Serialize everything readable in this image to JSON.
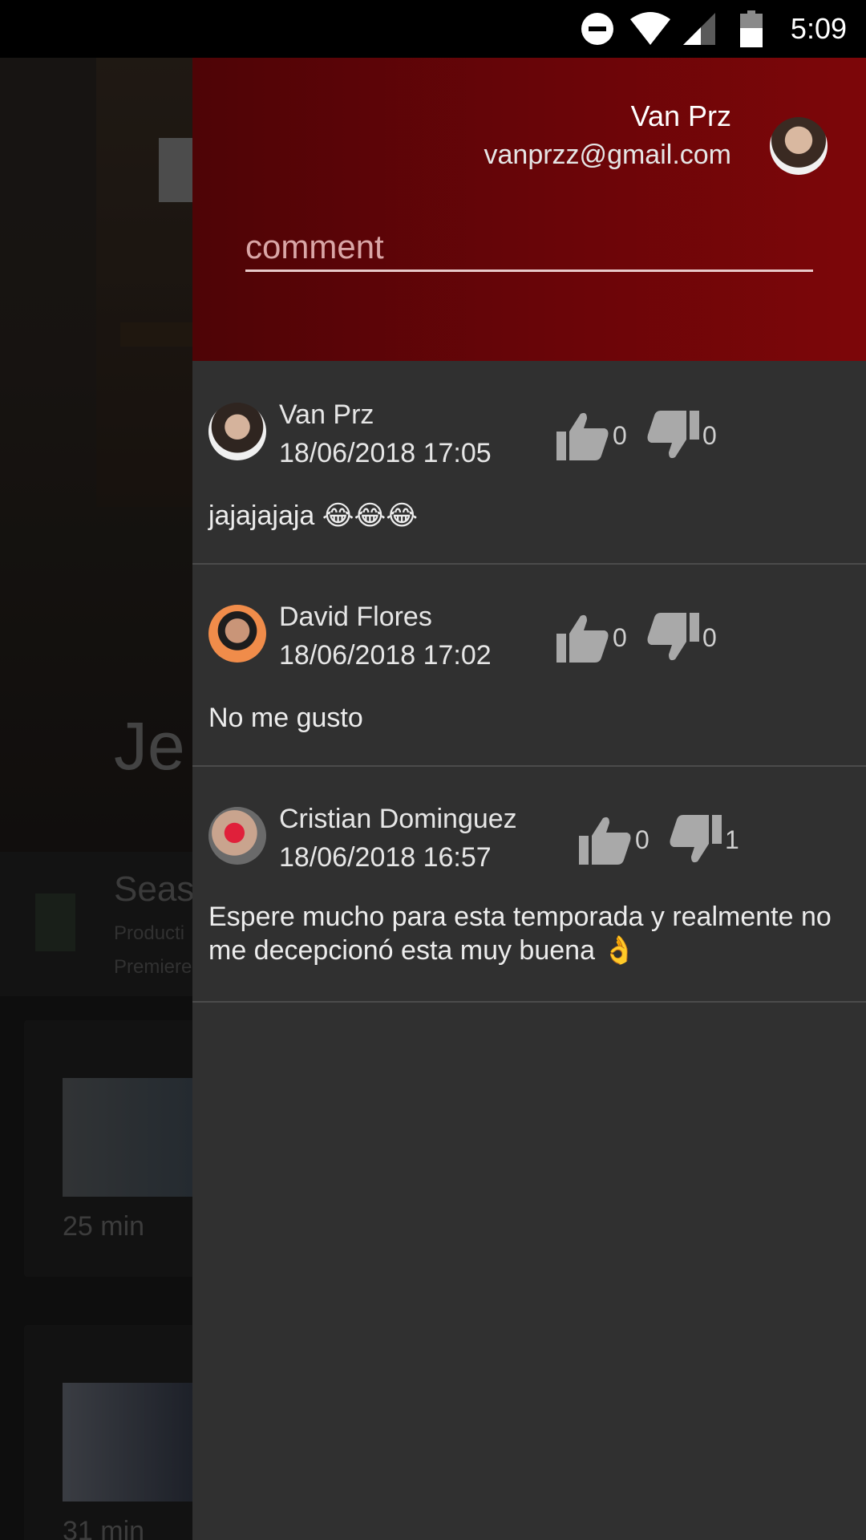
{
  "status_bar": {
    "time": "5:09",
    "icons": [
      "do-not-disturb-icon",
      "wifi-icon",
      "cellular-signal-icon",
      "battery-icon"
    ]
  },
  "background": {
    "show_title_partial": "Je",
    "season_title_partial": "Seas",
    "season_line1_partial": "Producti",
    "season_line2_partial": "Premiere",
    "episodes": [
      {
        "duration": "25 min"
      },
      {
        "duration": "31 min"
      }
    ]
  },
  "drawer": {
    "user": {
      "name": "Van Prz",
      "email": "vanprzz@gmail.com"
    },
    "comment_input": {
      "placeholder": "comment",
      "value": ""
    },
    "comments": [
      {
        "author": "Van Prz",
        "date": "18/06/2018 17:05",
        "likes": "0",
        "dislikes": "0",
        "text": "jajajajaja 😂😂😂"
      },
      {
        "author": "David Flores",
        "date": "18/06/2018 17:02",
        "likes": "0",
        "dislikes": "0",
        "text": "No me gusto"
      },
      {
        "author": "Cristian Dominguez",
        "date": "18/06/2018 16:57",
        "likes": "0",
        "dislikes": "1",
        "text": "Espere mucho para esta temporada y realmente no me decepcionó esta muy buena 👌"
      }
    ]
  },
  "colors": {
    "header_red": "#6a0508",
    "drawer_bg": "#303030",
    "divider": "#4b4b4b"
  }
}
